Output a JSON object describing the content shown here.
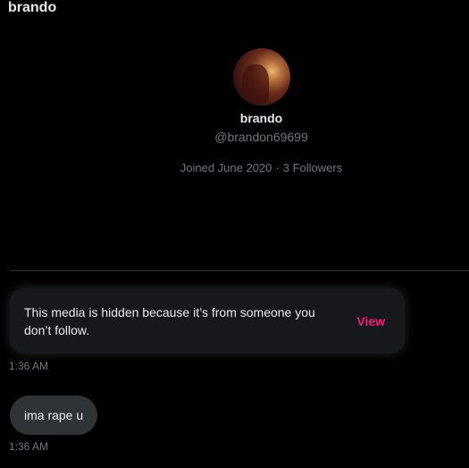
{
  "header": {
    "title": "brando"
  },
  "profile": {
    "avatar": "avatar-image",
    "name": "brando",
    "handle": "@brandon69699",
    "joined": "Joined June 2020",
    "separator": "·",
    "followers": "3 Followers"
  },
  "messages": [
    {
      "type": "hidden-media",
      "text": "This media is hidden because it’s from someone you don’t follow.",
      "action_label": "View",
      "time": "1:36 AM"
    },
    {
      "type": "text",
      "text": "ima rape u",
      "time": "1:36 AM"
    }
  ],
  "colors": {
    "background": "#000000",
    "text_primary": "#e7e9ea",
    "text_secondary": "#71767b",
    "accent_pink": "#f91880",
    "card": "#16181c",
    "bubble": "#2f3336",
    "divider": "#2f3336"
  }
}
